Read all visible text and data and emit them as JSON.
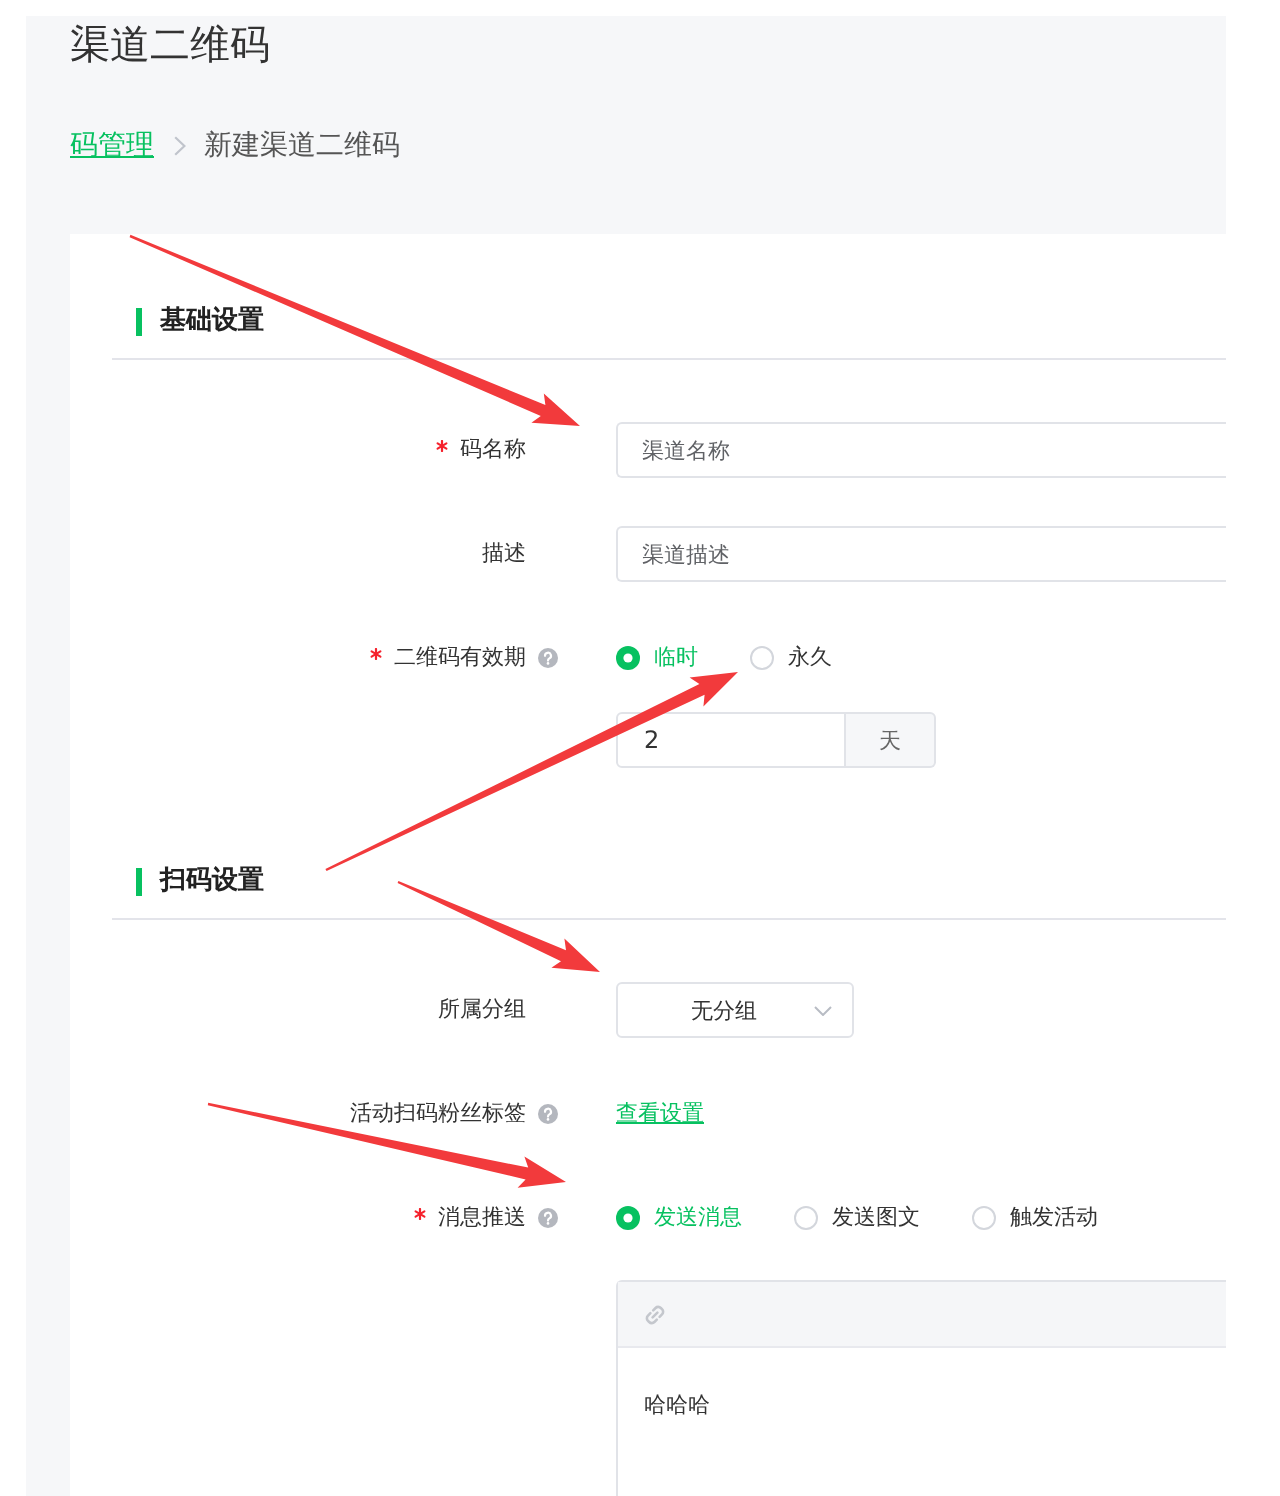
{
  "page": {
    "title": "渠道二维码"
  },
  "breadcrumb": [
    {
      "label": "码管理",
      "kind": "link"
    },
    {
      "label": "新建渠道二维码",
      "kind": "current"
    }
  ],
  "sections": [
    {
      "title": "基础设置",
      "fields": [
        {
          "kind": "text",
          "label": "码名称",
          "required": true,
          "help": false,
          "placeholder": "渠道名称"
        },
        {
          "kind": "text",
          "label": "描述",
          "required": false,
          "help": false,
          "placeholder": "渠道描述"
        },
        {
          "kind": "radio",
          "label": "二维码有效期",
          "required": true,
          "help": true,
          "options": [
            {
              "label": "临时",
              "selected": true
            },
            {
              "label": "永久",
              "selected": false
            }
          ],
          "duration": {
            "value": "2",
            "unit": "天"
          }
        }
      ]
    },
    {
      "title": "扫码设置",
      "fields": [
        {
          "kind": "select",
          "label": "所属分组",
          "required": false,
          "help": false,
          "value": "无分组"
        },
        {
          "kind": "link",
          "label": "活动扫码粉丝标签",
          "required": false,
          "help": true,
          "link": "查看设置"
        },
        {
          "kind": "radio",
          "label": "消息推送",
          "required": true,
          "help": true,
          "options": [
            {
              "label": "发送消息",
              "selected": true
            },
            {
              "label": "发送图文",
              "selected": false
            },
            {
              "label": "触发活动",
              "selected": false
            }
          ],
          "editor": {
            "content": "哈哈哈"
          }
        }
      ]
    }
  ]
}
